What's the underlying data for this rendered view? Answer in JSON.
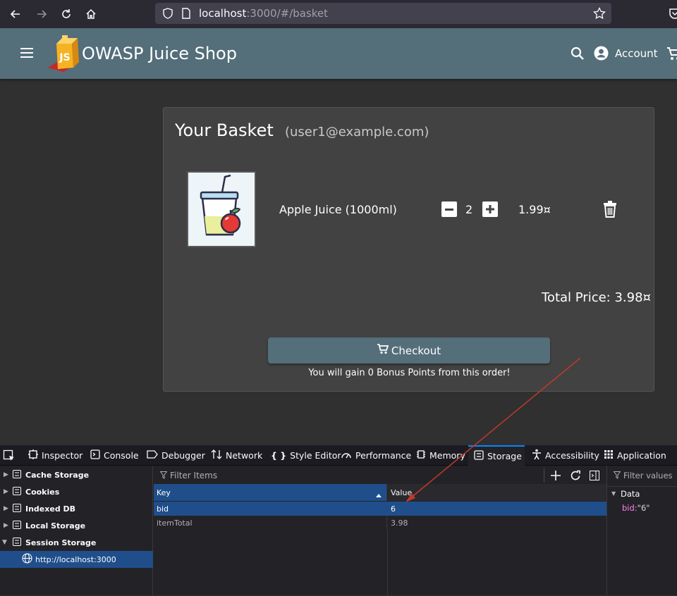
{
  "browser": {
    "url_host": "localhost",
    "url_rest": ":3000/#/basket"
  },
  "app": {
    "title": "OWASP Juice Shop",
    "account_label": "Account",
    "logo_text": "JS"
  },
  "basket": {
    "title": "Your Basket",
    "user_email": "(user1@example.com)",
    "items": [
      {
        "name": "Apple Juice (1000ml)",
        "quantity": "2",
        "price": "1.99¤"
      }
    ],
    "total_price": "Total Price: 3.98¤",
    "checkout_label": "Checkout",
    "bonus_text": "You will gain 0 Bonus Points from this order!"
  },
  "devtools": {
    "tabs": [
      "Inspector",
      "Console",
      "Debugger",
      "Network",
      "Style Editor",
      "Performance",
      "Memory",
      "Storage",
      "Accessibility",
      "Application"
    ],
    "selected_tab": "Storage",
    "tree": [
      "Cache Storage",
      "Cookies",
      "Indexed DB",
      "Local Storage",
      "Session Storage"
    ],
    "tree_child": "http://localhost:3000",
    "filter_placeholder": "Filter Items",
    "filter_values_placeholder": "Filter values",
    "columns": {
      "key": "Key",
      "value": "Value"
    },
    "rows": [
      {
        "key": "bid",
        "value": "6"
      },
      {
        "key": "itemTotal",
        "value": "3.98"
      }
    ],
    "data_header": "Data",
    "data_key": "bid",
    "data_sep": ":",
    "data_value": "\"6\""
  },
  "colors": {
    "toolbar": "#546e7a",
    "card": "#424242",
    "background": "#303030",
    "selection": "#204e8a",
    "annotation_arrow": "#c0392b"
  }
}
